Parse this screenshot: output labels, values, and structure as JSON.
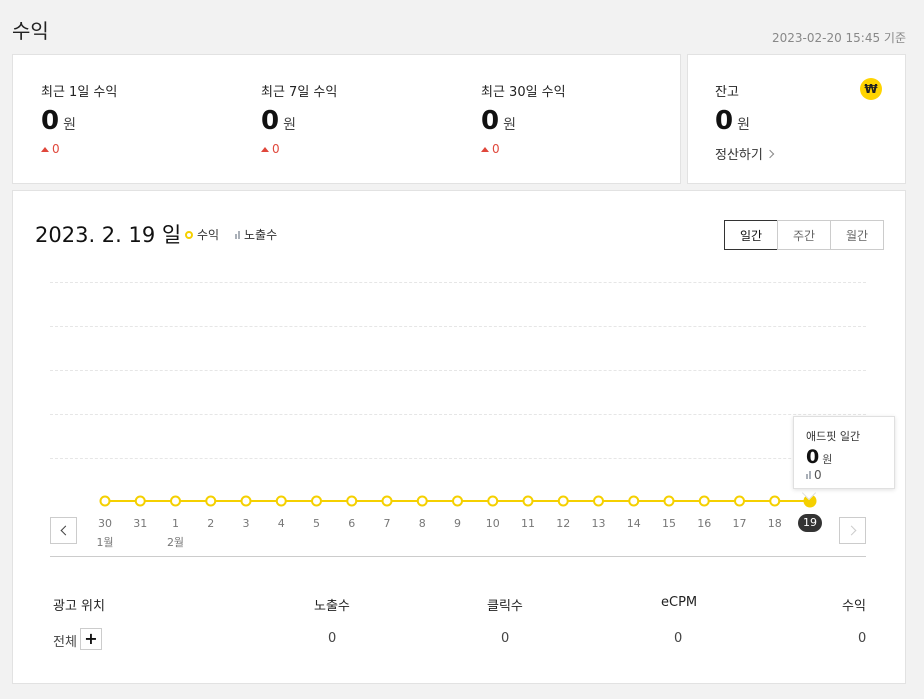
{
  "page": {
    "title": "수익",
    "timestamp": "2023-02-20 15:45 기준"
  },
  "summary": [
    {
      "label": "최근 1일 수익",
      "value": "0",
      "unit": "원",
      "delta": "0"
    },
    {
      "label": "최근 7일 수익",
      "value": "0",
      "unit": "원",
      "delta": "0"
    },
    {
      "label": "최근 30일 수익",
      "value": "0",
      "unit": "원",
      "delta": "0"
    }
  ],
  "balance": {
    "label": "잔고",
    "value": "0",
    "unit": "원",
    "icon_symbol": "₩",
    "icon": "won-coin-icon",
    "settle_label": "정산하기"
  },
  "chart": {
    "date": "2023. 2. 19 일",
    "legend_revenue": "수익",
    "legend_impressions": "노출수",
    "periods": [
      "일간",
      "주간",
      "월간"
    ],
    "active_period": "일간",
    "accent_color": "#f5d000",
    "tooltip": {
      "title": "애드핏 일간",
      "value": "0",
      "unit": "원",
      "impressions": "0"
    }
  },
  "chart_data": {
    "type": "line",
    "x": [
      "30",
      "31",
      "1",
      "2",
      "3",
      "4",
      "5",
      "6",
      "7",
      "8",
      "9",
      "10",
      "11",
      "12",
      "13",
      "14",
      "15",
      "16",
      "17",
      "18",
      "19"
    ],
    "month_labels": [
      {
        "at": "30",
        "label": "1월"
      },
      {
        "at": "1",
        "label": "2월"
      }
    ],
    "selected": "19",
    "series": [
      {
        "name": "수익",
        "values": [
          0,
          0,
          0,
          0,
          0,
          0,
          0,
          0,
          0,
          0,
          0,
          0,
          0,
          0,
          0,
          0,
          0,
          0,
          0,
          0,
          0
        ]
      }
    ],
    "grid": true
  },
  "table": {
    "headers": [
      "광고 위치",
      "노출수",
      "클릭수",
      "eCPM",
      "수익"
    ],
    "rows": [
      {
        "position": "전체",
        "impressions": "0",
        "clicks": "0",
        "ecpm": "0",
        "revenue": "0"
      }
    ],
    "expand_symbol": "+"
  }
}
